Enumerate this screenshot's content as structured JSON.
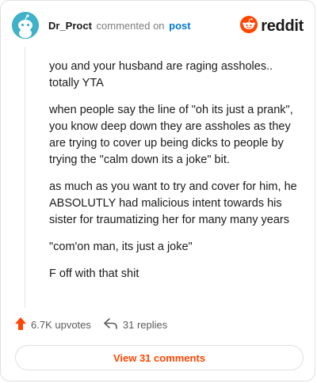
{
  "header": {
    "username": "Dr_Proct",
    "action": "commented on",
    "post_link": "post",
    "brand": "reddit"
  },
  "comment": {
    "paragraphs": [
      "you and your husband are raging assholes..\ntotally YTA",
      "when people say the line of \"oh its just a prank\",\nyou know deep down they are assholes as they\nare trying to cover up being dicks to people by\ntrying the \"calm down its a joke\" bit.",
      "as much as you want to try and cover for him, he\nABSOLUTLY had malicious intent towards his\nsister for traumatizing her for many many years",
      "\"com'on man, its just a joke\"",
      "F off with that shit"
    ]
  },
  "footer": {
    "upvotes": "6.7K upvotes",
    "replies": "31 replies"
  },
  "view_button": "View 31 comments",
  "colors": {
    "accent": "#ff4500",
    "link": "#0079d3",
    "avatar": "#3fb1c8"
  },
  "icons": [
    "snoo-avatar-icon",
    "reddit-logo-icon",
    "upvote-arrow-icon",
    "reply-arrow-icon"
  ]
}
